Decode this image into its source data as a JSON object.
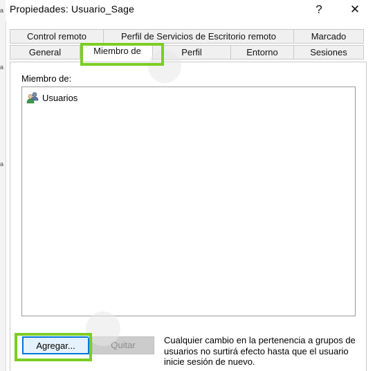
{
  "window": {
    "title": "Propiedades: Usuario_Sage",
    "help_label": "?",
    "close_label": "✕",
    "help_icon": "question-icon",
    "close_icon": "close-icon"
  },
  "background_window": {
    "edge_letters": [
      "a",
      "a",
      "a"
    ]
  },
  "tabs": {
    "row1": [
      {
        "label": "Control remoto"
      },
      {
        "label": "Perfil de Servicios de Escritorio remoto"
      },
      {
        "label": "Marcado"
      }
    ],
    "row2": [
      {
        "label": "General"
      },
      {
        "label": "Miembro de",
        "active": true
      },
      {
        "label": "Perfil"
      },
      {
        "label": "Entorno"
      },
      {
        "label": "Sesiones"
      }
    ]
  },
  "member_of": {
    "label": "Miembro de:",
    "items": [
      {
        "name": "Usuarios",
        "icon": "user-group-icon"
      }
    ]
  },
  "buttons": {
    "add_label": "Agregar...",
    "remove_label": "Quitar"
  },
  "note": "Cualquier cambio en la pertenencia a grupos de usuarios no surtirá efecto hasta que el usuario inicie sesión de nuevo.",
  "colors": {
    "highlight": "#7ccd23",
    "focus_border": "#0078d7",
    "disabled_button": "#cccccc"
  }
}
